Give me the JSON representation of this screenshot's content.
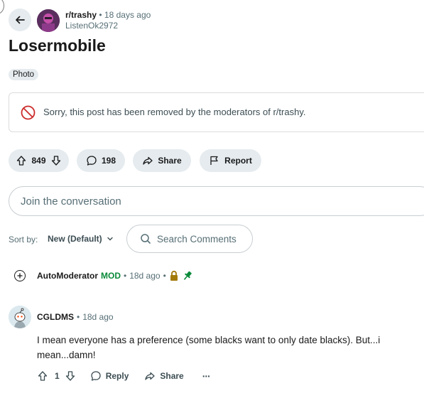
{
  "post": {
    "subreddit": "r/trashy",
    "time_ago": "18 days ago",
    "author": "ListenOk2972",
    "title": "Losermobile",
    "flair": "Photo",
    "removed_notice": "Sorry, this post has been removed by the moderators of r/trashy.",
    "votes": "849",
    "comments_count": "198",
    "share_label": "Share",
    "report_label": "Report"
  },
  "conversation": {
    "placeholder": "Join the conversation"
  },
  "sort": {
    "label": "Sort by:",
    "value": "New (Default)"
  },
  "search": {
    "placeholder": "Search Comments"
  },
  "comments": [
    {
      "author": "AutoModerator",
      "badge": "MOD",
      "time_ago": "18d ago",
      "separator": "•"
    },
    {
      "author": "CGLDMS",
      "time_ago": "18d ago",
      "separator": "•",
      "body": "I mean everyone has a preference (some blacks want to only date blacks). But...i mean...damn!",
      "votes": "1",
      "reply_label": "Reply",
      "share_label": "Share",
      "more_label": "···"
    }
  ],
  "colors": {
    "mod_green": "#0a8a3a",
    "removed_red": "#cc2b2b",
    "pill_bg": "#e5ebee",
    "lock_gold": "#a37b0c"
  }
}
